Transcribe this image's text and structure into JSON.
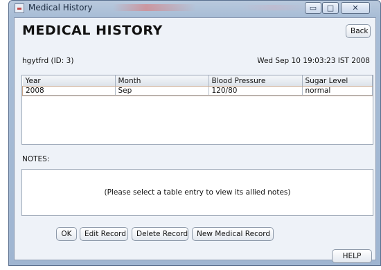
{
  "window": {
    "title": "Medical History",
    "controls": {
      "minimize": "▭",
      "maximize": "□",
      "close": "✕"
    }
  },
  "header": {
    "title": "MEDICAL HISTORY",
    "back_label": "Back"
  },
  "patient": {
    "label": "hgytfrd  (ID: 3)",
    "datetime": "Wed Sep 10 19:03:23 IST 2008"
  },
  "table": {
    "columns": [
      "Year",
      "Month",
      "Blood Pressure",
      "Sugar Level"
    ],
    "rows": [
      [
        "2008",
        "Sep",
        "120/80",
        "normal"
      ]
    ]
  },
  "notes": {
    "label": "NOTES:",
    "placeholder": "(Please select a table entry to view its allied notes)"
  },
  "actions": {
    "ok": "OK",
    "edit": "Edit Record",
    "delete": "Delete Record",
    "new": "New Medical Record",
    "help": "HELP"
  },
  "icons": {
    "app": "window-app-icon"
  }
}
